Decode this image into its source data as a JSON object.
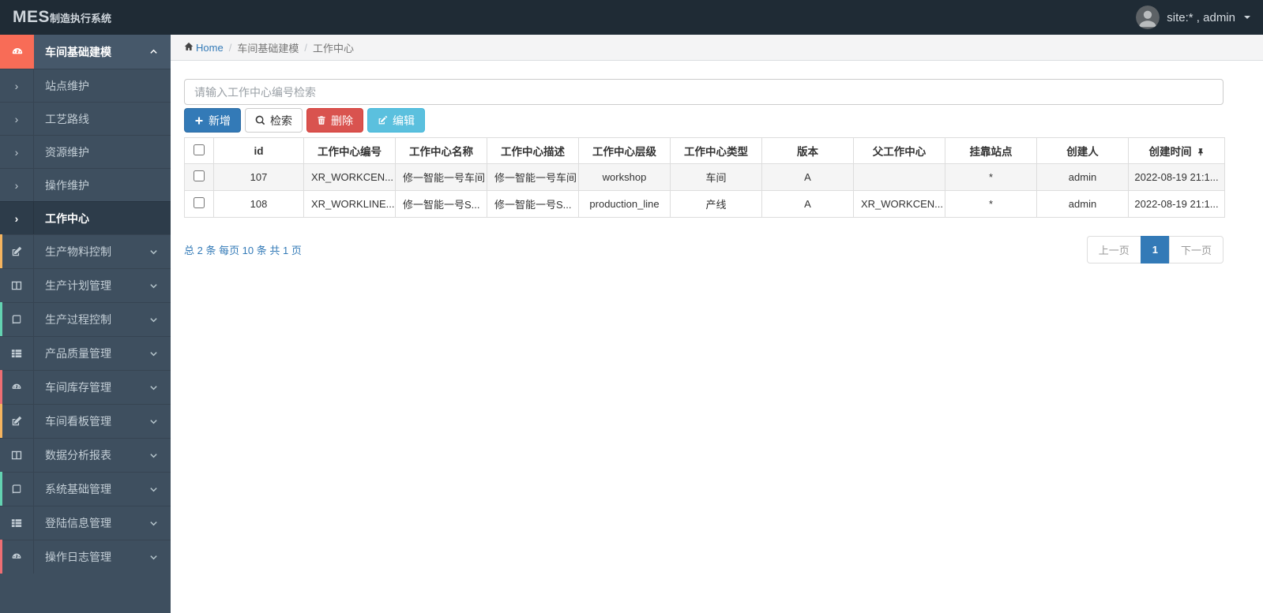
{
  "colors": {
    "navbar_bg": "#1f2b35",
    "sidebar_bg": "#3e4f5f",
    "sidebar_group_active_bg": "#46586a",
    "sidebar_submenu_active_bg": "#2d3c4a",
    "group_icon_bg": "#f86c57",
    "accent_yellow": "#f5b45f",
    "accent_teal": "#63d2b1",
    "accent_red": "#ee6e73",
    "primary_blue": "#337ab7",
    "danger_red": "#d9534f",
    "info_blue": "#5bc0de"
  },
  "navbar": {
    "logo_main": "MES",
    "logo_suffix": "制造执行系统",
    "user_label": "site:* , admin"
  },
  "breadcrumb": {
    "home": "Home",
    "sep": "/",
    "section": "车间基础建模",
    "current": "工作中心"
  },
  "sidebar": {
    "group": {
      "label": "车间基础建模",
      "icon": "gauge-icon",
      "expanded": true
    },
    "submenu": [
      {
        "label": "站点维护",
        "active": false
      },
      {
        "label": "工艺路线",
        "active": false
      },
      {
        "label": "资源维护",
        "active": false
      },
      {
        "label": "操作维护",
        "active": false
      },
      {
        "label": "工作中心",
        "active": true
      }
    ],
    "items": [
      {
        "label": "生产物料控制",
        "icon": "pencil-square-icon",
        "accent": "#f5b45f"
      },
      {
        "label": "生产计划管理",
        "icon": "columns-icon",
        "accent": ""
      },
      {
        "label": "生产过程控制",
        "icon": "book-icon",
        "accent": "#63d2b1"
      },
      {
        "label": "产品质量管理",
        "icon": "list-icon",
        "accent": ""
      },
      {
        "label": "车间库存管理",
        "icon": "gauge-icon",
        "accent": "#ee6e73"
      },
      {
        "label": "车间看板管理",
        "icon": "pencil-square-icon",
        "accent": "#f5b45f"
      },
      {
        "label": "数据分析报表",
        "icon": "columns-icon",
        "accent": ""
      },
      {
        "label": "系统基础管理",
        "icon": "book-icon",
        "accent": "#63d2b1"
      },
      {
        "label": "登陆信息管理",
        "icon": "list-icon",
        "accent": ""
      },
      {
        "label": "操作日志管理",
        "icon": "gauge-icon",
        "accent": "#ee6e73"
      }
    ]
  },
  "toolbar": {
    "search_placeholder": "请输入工作中心编号检索",
    "add_label": "新增",
    "search_label": "检索",
    "delete_label": "删除",
    "edit_label": "编辑"
  },
  "table": {
    "columns": [
      "id",
      "工作中心编号",
      "工作中心名称",
      "工作中心描述",
      "工作中心层级",
      "工作中心类型",
      "版本",
      "父工作中心",
      "挂靠站点",
      "创建人",
      "创建时间"
    ],
    "rows": [
      {
        "cells": [
          "107",
          "XR_WORKCEN...",
          "修一智能一号车间",
          "修一智能一号车间",
          "workshop",
          "车间",
          "A",
          "",
          "*",
          "admin",
          "2022-08-19 21:1..."
        ]
      },
      {
        "cells": [
          "108",
          "XR_WORKLINE...",
          "修一智能一号S...",
          "修一智能一号S...",
          "production_line",
          "产线",
          "A",
          "XR_WORKCEN...",
          "*",
          "admin",
          "2022-08-19 21:1..."
        ]
      }
    ]
  },
  "pagination": {
    "summary": "总 2 条 每页 10 条 共 1 页",
    "prev": "上一页",
    "page": "1",
    "next": "下一页"
  }
}
